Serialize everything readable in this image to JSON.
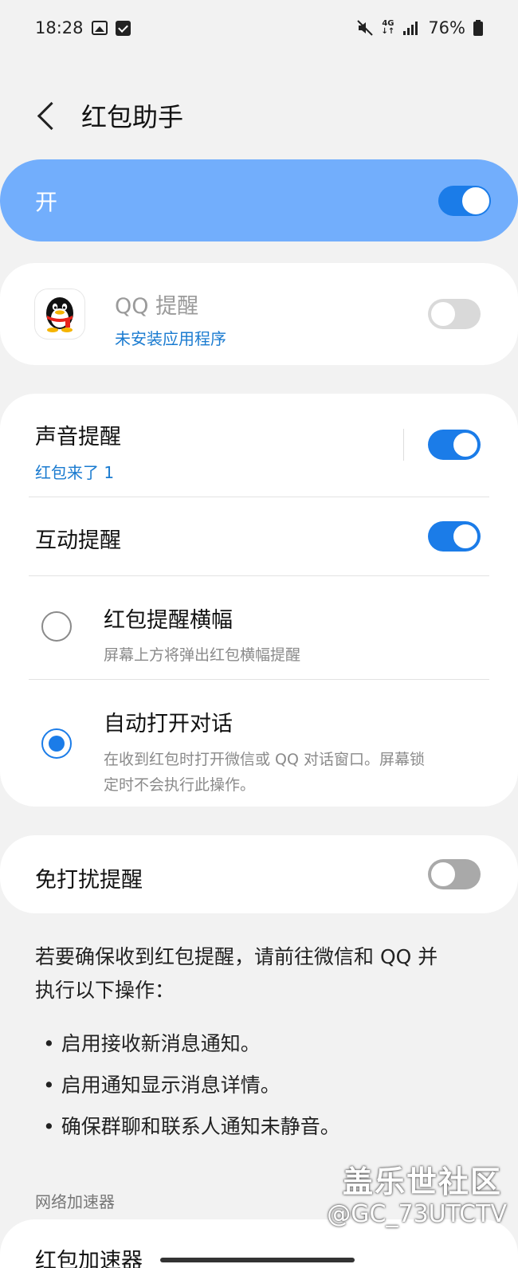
{
  "status_bar": {
    "time": "18:28",
    "network": "4G",
    "battery": "76%"
  },
  "header": {
    "title": "红包助手"
  },
  "master_switch": {
    "label": "开",
    "on": true
  },
  "qq_card": {
    "title": "QQ 提醒",
    "subtitle": "未安装应用程序",
    "on": false
  },
  "settings_card": {
    "sound": {
      "title": "声音提醒",
      "subtitle": "红包来了 1",
      "on": true
    },
    "interactive": {
      "title": "互动提醒",
      "on": true
    },
    "banner": {
      "title": "红包提醒横幅",
      "subtitle": "屏幕上方将弹出红包横幅提醒",
      "selected": false
    },
    "auto_open": {
      "title": "自动打开对话",
      "subtitle_line1": "在收到红包时打开微信或 QQ 对话窗口。屏幕锁",
      "subtitle_line2": "定时不会执行此操作。",
      "selected": true
    }
  },
  "dnd_card": {
    "title": "免打扰提醒",
    "on": false
  },
  "note": {
    "line1": "若要确保收到红包提醒，请前往微信和 QQ 并",
    "line2": "执行以下操作：",
    "bullets": [
      "• 启用接收新消息通知。",
      "• 启用通知显示消息详情。",
      "• 确保群聊和联系人通知未静音。"
    ]
  },
  "section": {
    "label": "网络加速器"
  },
  "partial_item": {
    "title": "红包加速器"
  },
  "watermark": {
    "line1": "盖乐世社区",
    "line2": "@GC_73UTCTV"
  },
  "colors": {
    "accent": "#1b7ce8",
    "master_bg": "#72aefc",
    "link": "#1a7bd0"
  }
}
